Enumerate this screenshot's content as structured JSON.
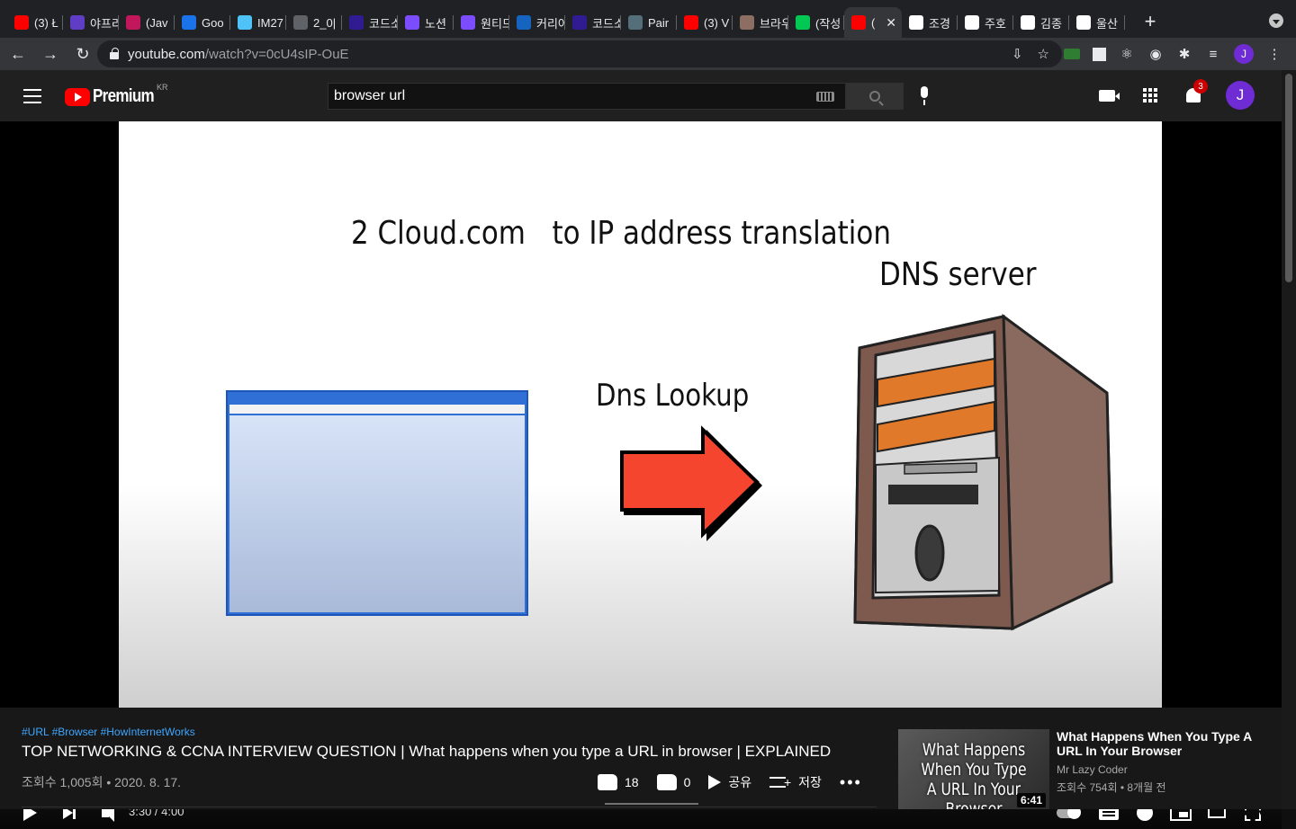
{
  "browser": {
    "tabs": [
      {
        "title": "(3) Ł",
        "favicon": "youtube-icon",
        "color": "#ff0000"
      },
      {
        "title": "야프리",
        "favicon": "app-icon",
        "color": "#5f3dc4"
      },
      {
        "title": "(Jav",
        "favicon": "zero-icon",
        "color": "#c2185b"
      },
      {
        "title": "Goo",
        "favicon": "calendar-icon",
        "color": "#1a73e8"
      },
      {
        "title": "IM27",
        "favicon": "diamond-icon",
        "color": "#4fc3f7"
      },
      {
        "title": "2_0|",
        "favicon": "globe-icon",
        "color": "#5f6368"
      },
      {
        "title": "코드소",
        "favicon": "code-icon",
        "color": "#311b92"
      },
      {
        "title": "노션",
        "favicon": "notion-icon",
        "color": "#7c4dff"
      },
      {
        "title": "원티드",
        "favicon": "wanted-icon",
        "color": "#7c4dff"
      },
      {
        "title": "커리어",
        "favicon": "career-icon",
        "color": "#1565c0"
      },
      {
        "title": "코드소",
        "favicon": "code-icon",
        "color": "#311b92"
      },
      {
        "title": "Pair",
        "favicon": "pair-icon",
        "color": "#546e7a"
      },
      {
        "title": "(3) V",
        "favicon": "youtube-icon",
        "color": "#ff0000"
      },
      {
        "title": "브라우",
        "favicon": "image-icon",
        "color": "#8d6e63"
      },
      {
        "title": "(작성",
        "favicon": "v-icon",
        "color": "#00c853"
      },
      {
        "title": "(",
        "favicon": "youtube-icon",
        "color": "#ff0000",
        "active": true
      },
      {
        "title": "조경",
        "favicon": "wiki-icon",
        "color": "#ffffff"
      },
      {
        "title": "주호",
        "favicon": "wiki-icon",
        "color": "#ffffff"
      },
      {
        "title": "김종",
        "favicon": "google-icon",
        "color": "#ffffff"
      },
      {
        "title": "울산",
        "favicon": "wiki-icon",
        "color": "#ffffff"
      }
    ],
    "close_glyph": "✕",
    "new_tab_glyph": "+",
    "url_host": "youtube.com",
    "url_path": "/watch?v=0cU4sIP-OuE",
    "profile_letter": "J"
  },
  "youtube": {
    "logo_text": "Premium",
    "region": "KR",
    "search_value": "browser url",
    "notification_count": "3",
    "avatar_letter": "J"
  },
  "player": {
    "slide_title": "2 Cloud.com   to IP address translation",
    "dns_label": "DNS server",
    "lookup_label": "Dns Lookup",
    "time_display": "3:30 / 4:00",
    "progress_fraction": 0.875,
    "settings_badge": "HD"
  },
  "video": {
    "hashtags": "#URL #Browser #HowInternetWorks",
    "title": "TOP NETWORKING & CCNA INTERVIEW QUESTION | What happens when you type a URL in browser | EXPLAINED",
    "meta": "조회수 1,005회 • 2020. 8. 17.",
    "likes": "18",
    "dislikes": "0",
    "share_label": "공유",
    "save_label": "저장",
    "more_glyph": "•••"
  },
  "recommendation": {
    "thumb_text": "What Happens When You Type A URL In Your Browser",
    "duration": "6:41",
    "title": "What Happens When You Type A URL In Your Browser",
    "channel": "Mr Lazy Coder",
    "meta": "조회수 754회 • 8개월 전"
  }
}
